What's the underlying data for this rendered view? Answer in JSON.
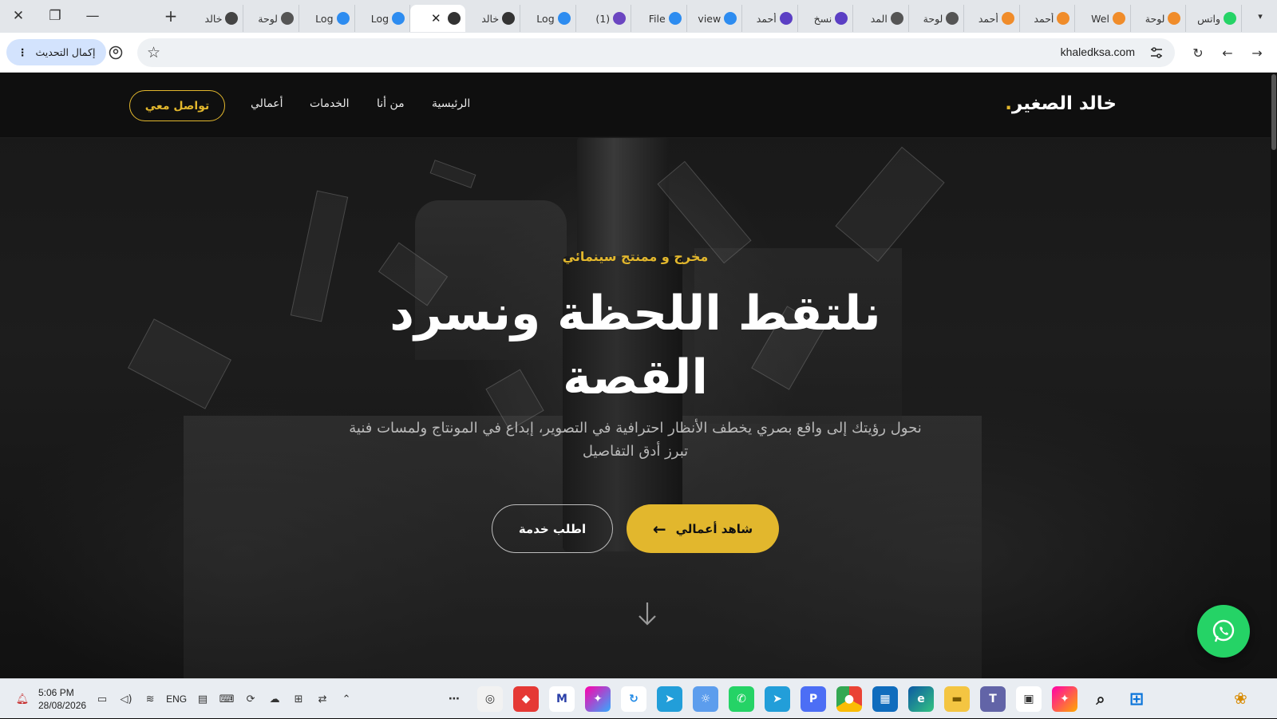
{
  "browser": {
    "tabs": [
      {
        "title": "واتس",
        "icon": "whatsapp-icon",
        "color": "#25d366"
      },
      {
        "title": "لوحة",
        "icon": "orange-logo-icon",
        "color": "#f08c2a"
      },
      {
        "title": "Wel",
        "icon": "orange-logo-icon",
        "color": "#f08c2a"
      },
      {
        "title": "أحمد",
        "icon": "orange-logo-icon",
        "color": "#f08c2a"
      },
      {
        "title": "أحمد",
        "icon": "orange-logo-icon",
        "color": "#f08c2a"
      },
      {
        "title": "لوحة",
        "icon": "globe-icon",
        "color": "#555555"
      },
      {
        "title": "المد",
        "icon": "globe-icon",
        "color": "#555555"
      },
      {
        "title": "نسخ",
        "icon": "h-logo-icon",
        "color": "#5b3fc4"
      },
      {
        "title": "أحمد",
        "icon": "h-logo-icon",
        "color": "#5b3fc4"
      },
      {
        "title": "view",
        "icon": "blue-circle-icon",
        "color": "#2d8cf0"
      },
      {
        "title": "File",
        "icon": "blue-circle-icon",
        "color": "#2d8cf0"
      },
      {
        "title": "(1)",
        "icon": "purple-envelope-icon",
        "color": "#6b46c1"
      },
      {
        "title": "Log",
        "icon": "blue-circle-icon",
        "color": "#2d8cf0"
      },
      {
        "title": "خالد",
        "icon": "photo-icon",
        "color": "#333333"
      },
      {
        "title": "",
        "icon": "photo-icon",
        "color": "#333333",
        "active": true
      },
      {
        "title": "Log",
        "icon": "blue-circle-icon",
        "color": "#2d8cf0"
      },
      {
        "title": "Log",
        "icon": "blue-circle-icon",
        "color": "#2d8cf0"
      },
      {
        "title": "لوحة",
        "icon": "globe-icon",
        "color": "#555555"
      },
      {
        "title": "خالد",
        "icon": "avatar-icon",
        "color": "#444444"
      }
    ],
    "url": "khaledksa.com",
    "update_label": "إكمال التحديث"
  },
  "site": {
    "logo": "خالد الصغير",
    "logo_dot": ".",
    "nav": {
      "home": "الرئيسية",
      "about": "من أنا",
      "services": "الخدمات",
      "works": "أعمالي"
    },
    "contact_button": "تواصل معي",
    "hero": {
      "tagline": "مخرج و ممنتج سينمائي",
      "title": "نلتقط اللحظة ونسرد القصة",
      "description": "نحول رؤيتك إلى واقع بصري يخطف الأنظار احترافية في التصوير، إبداع في المونتاج ولمسات فنية تبرز أدق التفاصيل",
      "primary_button": "شاهد أعمالي",
      "secondary_button": "اطلب خدمة"
    },
    "accent_color": "#e2b72d"
  },
  "taskbar": {
    "time": "5:06 PM",
    "date": "28/08/2026",
    "language": "ENG"
  }
}
